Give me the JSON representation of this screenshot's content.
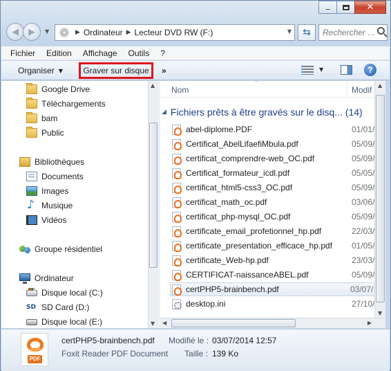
{
  "window": {
    "close_glyph": "✕"
  },
  "address_bar": {
    "crumbs": [
      "Ordinateur",
      "Lecteur DVD RW (F:)"
    ],
    "separator": "▶"
  },
  "search": {
    "placeholder": "Rechercher ..."
  },
  "menu": {
    "items": [
      "Fichier",
      "Edition",
      "Affichage",
      "Outils",
      "?"
    ]
  },
  "command_bar": {
    "organiser_label": "Organiser",
    "graver_label": "Graver sur disque",
    "more_label": "»",
    "highlight_color": "#e0141b"
  },
  "nav_pane": {
    "favorites": [
      "Google Drive",
      "Téléchargements",
      "bam",
      "Public"
    ],
    "libraries_label": "Bibliothèques",
    "libraries": [
      "Documents",
      "Images",
      "Musique",
      "Vidéos"
    ],
    "homegroup_label": "Groupe résidentiel",
    "computer_label": "Ordinateur",
    "drives": [
      "Disque local (C:)",
      "SD Card (D:)",
      "Disque local (E:)"
    ]
  },
  "content": {
    "column_name": "Nom",
    "column_date": "Modif",
    "group_title": "Fichiers prêts à être gravés sur le disq... (14)",
    "files": [
      {
        "name": "abel-diplome.PDF",
        "date": "01/01/",
        "type": "pdf"
      },
      {
        "name": "Certificat_AbelLifaefiMbula.pdf",
        "date": "05/09/",
        "type": "pdf"
      },
      {
        "name": "certificat_comprendre-web_OC.pdf",
        "date": "05/09/",
        "type": "pdf"
      },
      {
        "name": "Certificat_formateur_icdl.pdf",
        "date": "05/05/",
        "type": "pdf"
      },
      {
        "name": "certificat_html5-css3_OC.pdf",
        "date": "05/09/",
        "type": "pdf"
      },
      {
        "name": "certificat_math_oc.pdf",
        "date": "03/06/",
        "type": "pdf"
      },
      {
        "name": "certificat_php-mysql_OC.pdf",
        "date": "05/09/",
        "type": "pdf"
      },
      {
        "name": "certificate_email_profetionnel_hp.pdf",
        "date": "22/03/",
        "type": "pdf"
      },
      {
        "name": "certificate_presentation_efficace_hp.pdf",
        "date": "01/05/",
        "type": "pdf"
      },
      {
        "name": "certificate_Web-hp.pdf",
        "date": "23/03/",
        "type": "pdf"
      },
      {
        "name": "CERTIFICAT-naissanceABEL.pdf",
        "date": "05/09/",
        "type": "pdf"
      },
      {
        "name": "certPHP5-brainbench.pdf",
        "date": "03/07/",
        "type": "pdf",
        "selected": true
      },
      {
        "name": "desktop.ini",
        "date": "27/10/",
        "type": "ini"
      }
    ]
  },
  "details": {
    "file_name": "certPHP5-brainbench.pdf",
    "file_type": "Foxit Reader PDF Document",
    "icon_tag": "PDF",
    "modified_label": "Modifié le :",
    "modified_value": "03/07/2014 12:57",
    "size_label": "Taille :",
    "size_value": "139 Ko"
  }
}
